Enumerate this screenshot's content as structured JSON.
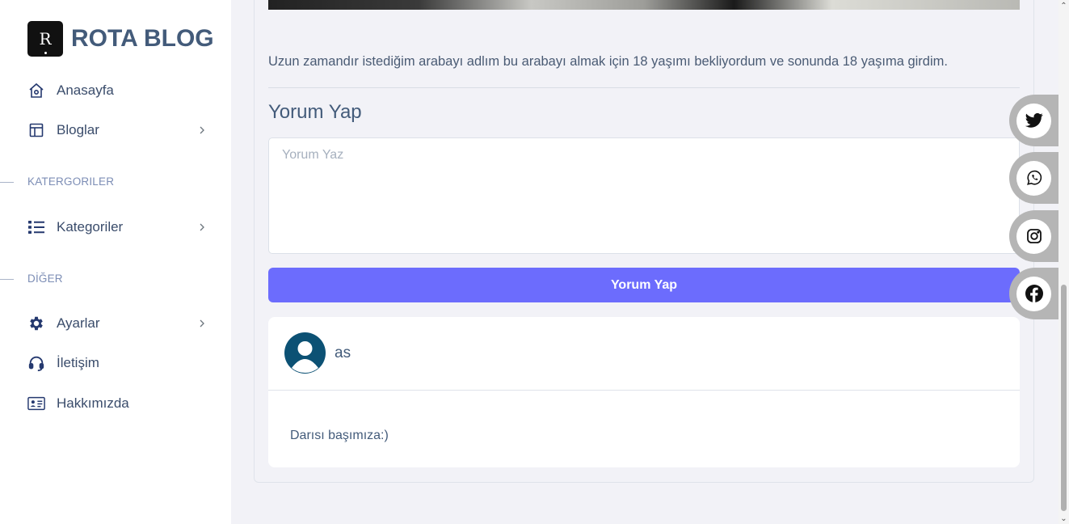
{
  "brand": {
    "logo_letter": "R",
    "title": "ROTA BLOG"
  },
  "sidebar": {
    "items": [
      {
        "label": "Anasayfa",
        "icon": "home-icon"
      },
      {
        "label": "Bloglar",
        "icon": "layout-icon",
        "has_submenu": true
      }
    ],
    "sections": [
      {
        "title": "KATERGORILER",
        "items": [
          {
            "label": "Kategoriler",
            "icon": "list-icon",
            "has_submenu": true
          }
        ]
      },
      {
        "title": "DİĞER",
        "items": [
          {
            "label": "Ayarlar",
            "icon": "gear-icon",
            "has_submenu": true
          },
          {
            "label": "İletişim",
            "icon": "headset-icon"
          },
          {
            "label": "Hakkımızda",
            "icon": "id-card-icon"
          }
        ]
      }
    ]
  },
  "post": {
    "text": "Uzun zamandır istediğim arabayı adlım bu arabayı almak için 18 yaşımı bekliyordum ve sonunda 18 yaşıma girdim."
  },
  "comment_form": {
    "heading": "Yorum Yap",
    "placeholder": "Yorum Yaz",
    "value": "",
    "submit_label": "Yorum Yap"
  },
  "comments": [
    {
      "author": "as",
      "text": "Darısı başımıza:)"
    }
  ],
  "social": [
    {
      "name": "twitter-icon"
    },
    {
      "name": "whatsapp-icon"
    },
    {
      "name": "instagram-icon"
    },
    {
      "name": "facebook-icon"
    }
  ],
  "colors": {
    "accent": "#6c6cfd",
    "avatar": "#0c5174",
    "social_bg": "#b5b5b5"
  }
}
